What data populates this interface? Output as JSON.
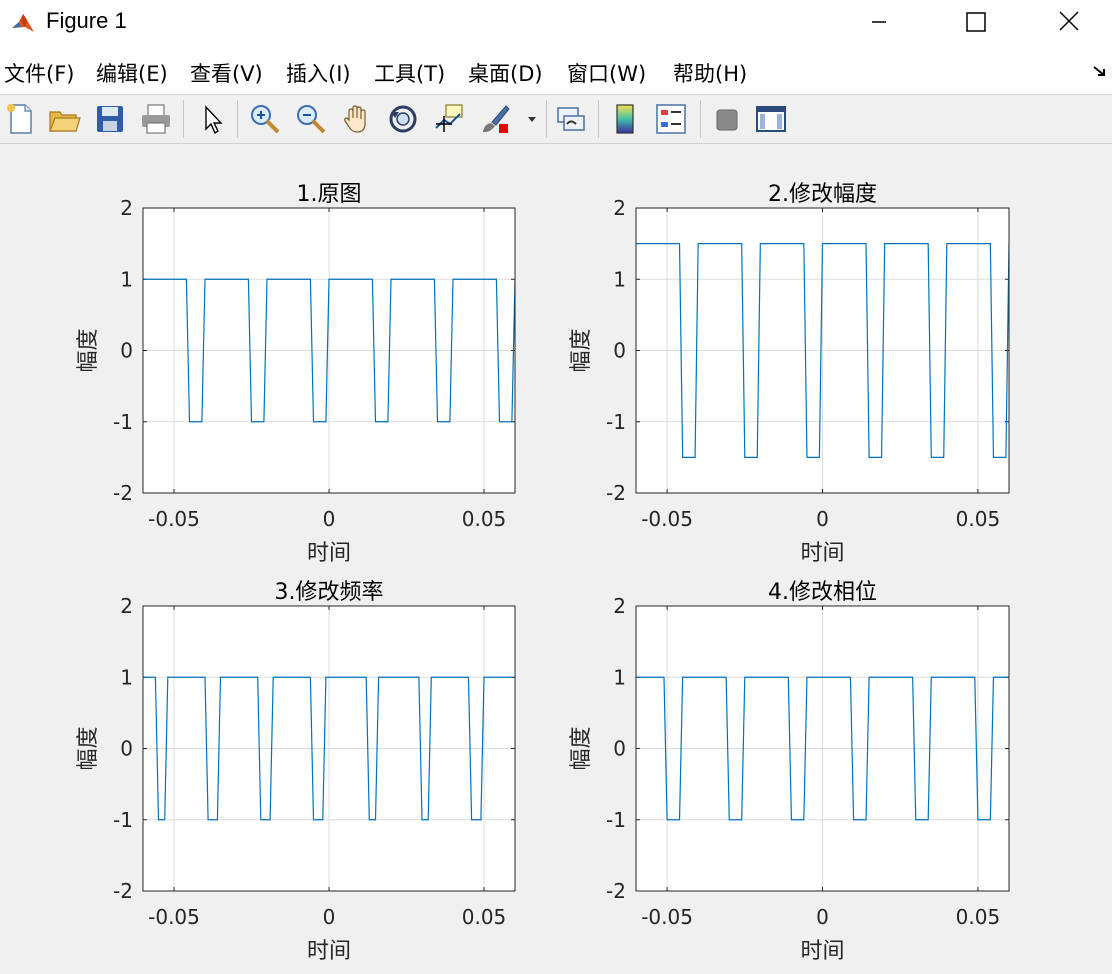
{
  "window": {
    "title": "Figure 1",
    "icon": "matlab-icon",
    "controls": [
      "minimize-icon",
      "maximize-icon",
      "close-icon"
    ]
  },
  "menu": {
    "items": [
      "文件(F)",
      "编辑(E)",
      "查看(V)",
      "插入(I)",
      "工具(T)",
      "桌面(D)",
      "窗口(W)",
      "帮助(H)"
    ],
    "dock_icon": "dock-arrow-icon"
  },
  "toolbar": {
    "icons": [
      "new-figure-icon",
      "open-file-icon",
      "save-icon",
      "print-icon",
      "pointer-icon",
      "zoom-in-icon",
      "zoom-out-icon",
      "pan-hand-icon",
      "rotate-3d-icon",
      "data-cursor-icon",
      "brush-icon",
      "brush-dropdown-icon",
      "link-plot-icon",
      "colorbar-icon",
      "legend-icon",
      "hide-plot-tools-icon",
      "show-plot-tools-icon"
    ]
  },
  "colors": {
    "line": "#0072bd",
    "grid": "#dddddd",
    "axes_background": "#ffffff",
    "figure_background": "#f0f0f0"
  },
  "chart_data": [
    {
      "type": "line",
      "title": "1.原图",
      "xlabel": "时间",
      "ylabel": "幅度",
      "xlim": [
        -0.06,
        0.06
      ],
      "ylim": [
        -2,
        2
      ],
      "xticks": [
        "-0.05",
        "0",
        "0.05"
      ],
      "yticks": [
        "2",
        "1",
        "0",
        "-1",
        "-2"
      ],
      "grid": true,
      "series": [
        {
          "x": [
            -0.06,
            -0.046,
            -0.045,
            -0.041,
            -0.04,
            -0.026,
            -0.025,
            -0.021,
            -0.02,
            -0.006,
            -0.005,
            -0.001,
            0.0,
            0.014,
            0.015,
            0.019,
            0.02,
            0.034,
            0.035,
            0.039,
            0.04,
            0.054,
            0.055,
            0.059,
            0.06
          ],
          "y": [
            1,
            1,
            -1,
            -1,
            1,
            1,
            -1,
            -1,
            1,
            1,
            -1,
            -1,
            1,
            1,
            -1,
            -1,
            1,
            1,
            -1,
            -1,
            1,
            1,
            -1,
            -1,
            1
          ]
        }
      ]
    },
    {
      "type": "line",
      "title": "2.修改幅度",
      "xlabel": "时间",
      "ylabel": "幅度",
      "xlim": [
        -0.06,
        0.06
      ],
      "ylim": [
        -2,
        2
      ],
      "xticks": [
        "-0.05",
        "0",
        "0.05"
      ],
      "yticks": [
        "2",
        "1",
        "0",
        "-1",
        "-2"
      ],
      "grid": true,
      "series": [
        {
          "x": [
            -0.06,
            -0.046,
            -0.045,
            -0.041,
            -0.04,
            -0.026,
            -0.025,
            -0.021,
            -0.02,
            -0.006,
            -0.005,
            -0.001,
            0.0,
            0.014,
            0.015,
            0.019,
            0.02,
            0.034,
            0.035,
            0.039,
            0.04,
            0.054,
            0.055,
            0.059,
            0.06
          ],
          "y": [
            1.5,
            1.5,
            -1.5,
            -1.5,
            1.5,
            1.5,
            -1.5,
            -1.5,
            1.5,
            1.5,
            -1.5,
            -1.5,
            1.5,
            1.5,
            -1.5,
            -1.5,
            1.5,
            1.5,
            -1.5,
            -1.5,
            1.5,
            1.5,
            -1.5,
            -1.5,
            1.5
          ]
        }
      ]
    },
    {
      "type": "line",
      "title": "3.修改频率",
      "xlabel": "时间",
      "ylabel": "幅度",
      "xlim": [
        -0.06,
        0.06
      ],
      "ylim": [
        -2,
        2
      ],
      "xticks": [
        "-0.05",
        "0",
        "0.05"
      ],
      "yticks": [
        "2",
        "1",
        "0",
        "-1",
        "-2"
      ],
      "grid": true,
      "series": [
        {
          "x": [
            -0.06,
            -0.056,
            -0.055,
            -0.053,
            -0.052,
            -0.04,
            -0.039,
            -0.036,
            -0.035,
            -0.023,
            -0.022,
            -0.019,
            -0.018,
            -0.006,
            -0.005,
            -0.002,
            -0.001,
            0.012,
            0.013,
            0.015,
            0.016,
            0.029,
            0.03,
            0.032,
            0.033,
            0.045,
            0.046,
            0.049,
            0.05,
            0.06
          ],
          "y": [
            1,
            1,
            -1,
            -1,
            1,
            1,
            -1,
            -1,
            1,
            1,
            -1,
            -1,
            1,
            1,
            -1,
            -1,
            1,
            1,
            -1,
            -1,
            1,
            1,
            -1,
            -1,
            1,
            1,
            -1,
            -1,
            1,
            1
          ]
        }
      ]
    },
    {
      "type": "line",
      "title": "4.修改相位",
      "xlabel": "时间",
      "ylabel": "幅度",
      "xlim": [
        -0.06,
        0.06
      ],
      "ylim": [
        -2,
        2
      ],
      "xticks": [
        "-0.05",
        "0",
        "0.05"
      ],
      "yticks": [
        "2",
        "1",
        "0",
        "-1",
        "-2"
      ],
      "grid": true,
      "series": [
        {
          "x": [
            -0.06,
            -0.051,
            -0.05,
            -0.046,
            -0.045,
            -0.031,
            -0.03,
            -0.026,
            -0.025,
            -0.011,
            -0.01,
            -0.006,
            -0.005,
            0.009,
            0.01,
            0.014,
            0.015,
            0.029,
            0.03,
            0.034,
            0.035,
            0.049,
            0.05,
            0.054,
            0.055,
            0.06
          ],
          "y": [
            1,
            1,
            -1,
            -1,
            1,
            1,
            -1,
            -1,
            1,
            1,
            -1,
            -1,
            1,
            1,
            -1,
            -1,
            1,
            1,
            -1,
            -1,
            1,
            1,
            -1,
            -1,
            1,
            1
          ]
        }
      ]
    }
  ]
}
